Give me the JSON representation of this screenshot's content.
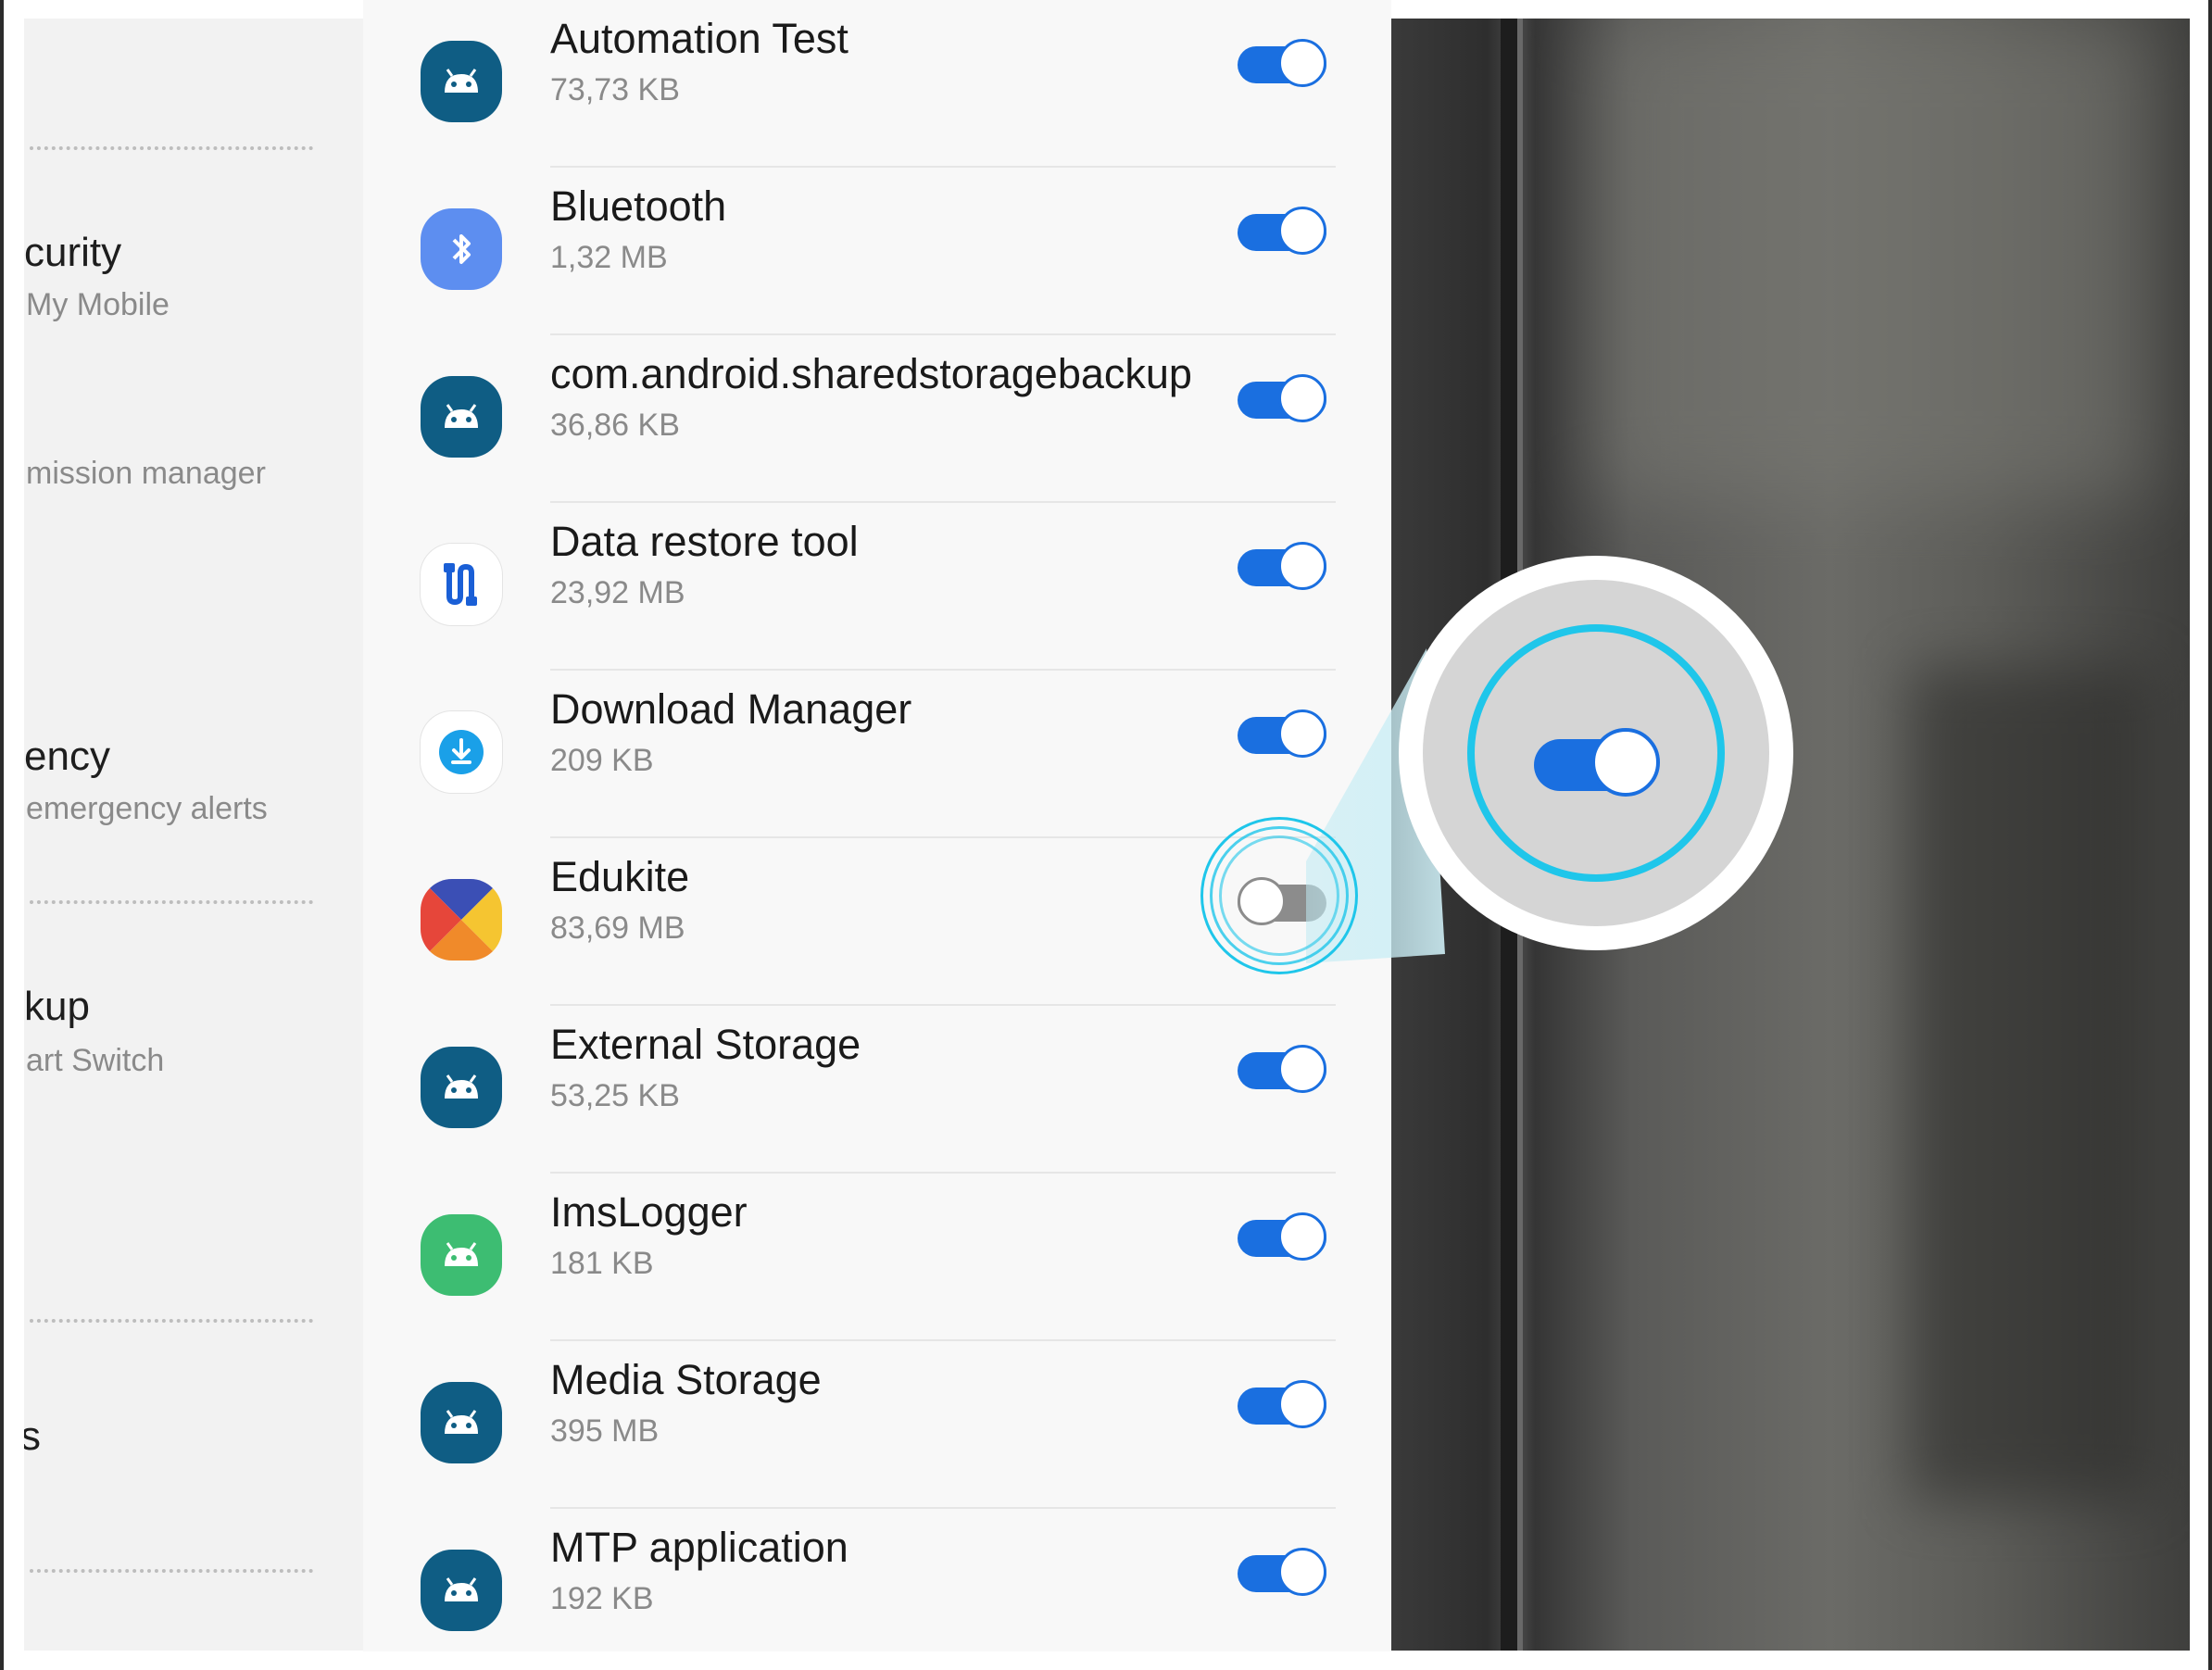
{
  "left_panel": {
    "items": [
      {
        "title": "curity",
        "subtitle": "My Mobile"
      },
      {
        "title": "",
        "subtitle": "mission manager"
      },
      {
        "title": "ency",
        "subtitle": "emergency alerts"
      },
      {
        "title": "kup",
        "subtitle": "art Switch"
      },
      {
        "title": "s",
        "subtitle": ""
      }
    ]
  },
  "apps": [
    {
      "name": "Automation Test",
      "size": "73,73 KB",
      "icon": "android-icon",
      "enabled": true
    },
    {
      "name": "Bluetooth",
      "size": "1,32 MB",
      "icon": "bluetooth-icon",
      "enabled": true
    },
    {
      "name": "com.android.sharedstoragebackup",
      "size": "36,86 KB",
      "icon": "android-icon",
      "enabled": true
    },
    {
      "name": "Data restore tool",
      "size": "23,92 MB",
      "icon": "data-restore-icon",
      "enabled": true
    },
    {
      "name": "Download Manager",
      "size": "209 KB",
      "icon": "download-icon",
      "enabled": true
    },
    {
      "name": "Edukite",
      "size": "83,69 MB",
      "icon": "edukite-icon",
      "enabled": false
    },
    {
      "name": "External Storage",
      "size": "53,25 KB",
      "icon": "android-icon",
      "enabled": true
    },
    {
      "name": "ImsLogger",
      "size": "181 KB",
      "icon": "android-green-icon",
      "enabled": true
    },
    {
      "name": "Media Storage",
      "size": "395 MB",
      "icon": "android-icon",
      "enabled": true
    },
    {
      "name": "MTP application",
      "size": "192 KB",
      "icon": "android-icon",
      "enabled": true
    }
  ],
  "zoom_callout": {
    "highlighted_toggle_state": "on"
  },
  "colors": {
    "toggle_on": "#1a6fe0",
    "toggle_off": "#8c8c8c",
    "highlight": "#1fc6ea"
  }
}
